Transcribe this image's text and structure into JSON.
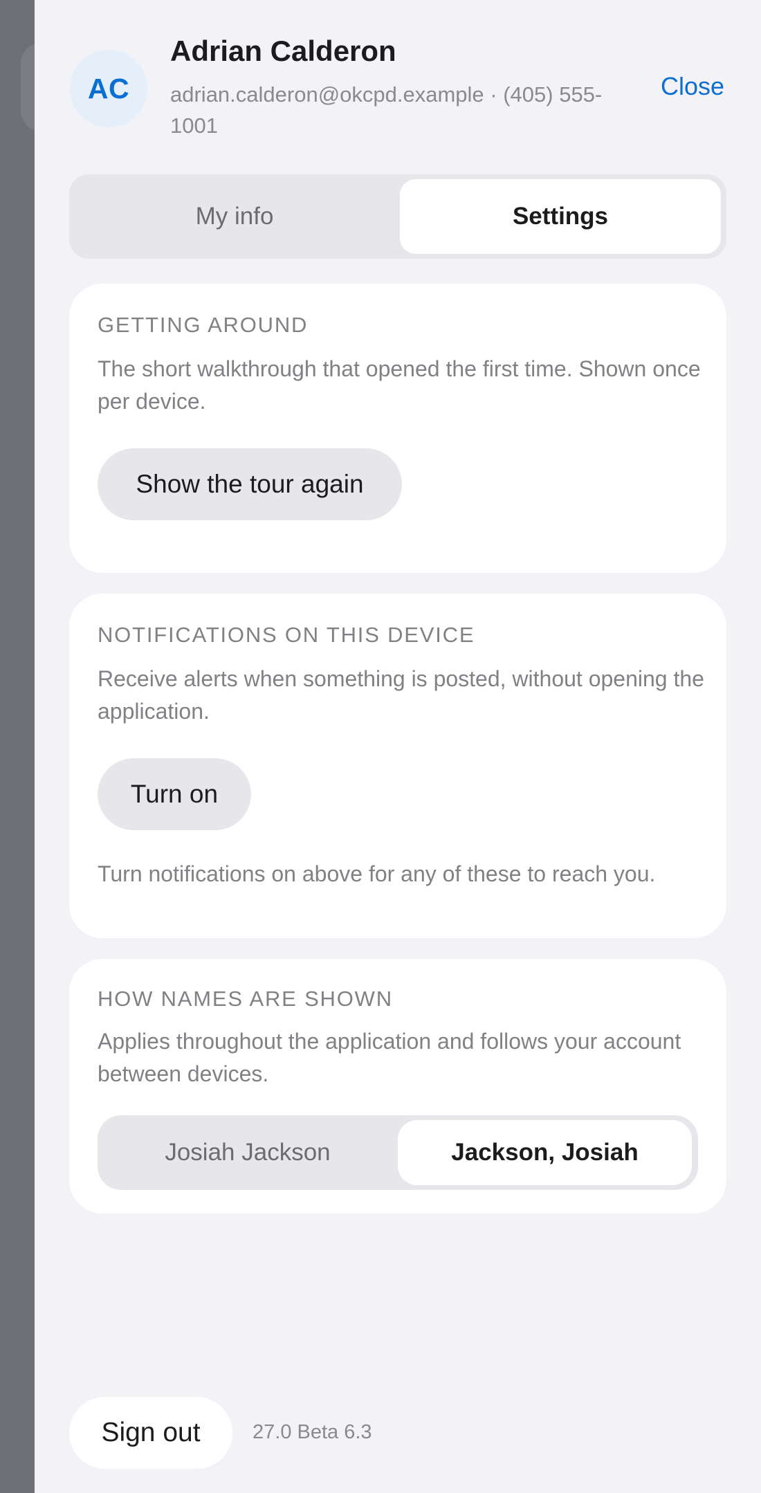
{
  "profile": {
    "initials": "AC",
    "name": "Adrian Calderon",
    "contact": "adrian.calderon@okcpd.example · (405) 555-1001",
    "close_label": "Close"
  },
  "tabs": [
    {
      "label": "My info",
      "selected": false
    },
    {
      "label": "Settings",
      "selected": true
    }
  ],
  "getting_around": {
    "heading": "GETTING AROUND",
    "description": "The short walkthrough that opened the first time. Shown once per device.",
    "button_label": "Show the tour again"
  },
  "notifications": {
    "heading": "NOTIFICATIONS ON THIS DEVICE",
    "description": "Receive alerts when something is posted, without opening the application.",
    "button_label": "Turn on",
    "note": "Turn notifications on above for any of these to reach you."
  },
  "names": {
    "heading": "HOW NAMES ARE SHOWN",
    "description": "Applies throughout the application and follows your account between devices.",
    "options": [
      {
        "label": "Josiah Jackson",
        "selected": false
      },
      {
        "label": "Jackson, Josiah",
        "selected": true
      }
    ]
  },
  "footer": {
    "sign_out_label": "Sign out",
    "version": "27.0 Beta 6.3"
  },
  "colors": {
    "accent": "#0a6fd1",
    "panel_background": "#f2f2f7",
    "backdrop": "#6e7075"
  }
}
